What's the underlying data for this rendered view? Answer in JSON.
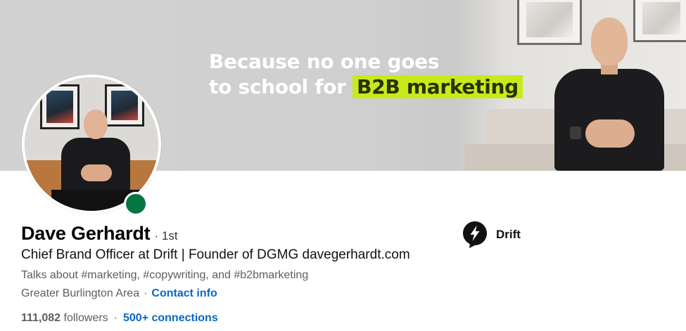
{
  "banner": {
    "tagline_line1": "Because no one goes",
    "tagline_line2_prefix": "to school for",
    "tagline_highlight": "B2B marketing",
    "highlight_color": "#c7ea1a"
  },
  "profile": {
    "name": "Dave Gerhardt",
    "degree": "· 1st",
    "headline": "Chief Brand Officer at Drift | Founder of DGMG davegerhardt.com",
    "topics": "Talks about #marketing, #copywriting, and #b2bmarketing",
    "location": "Greater Burlington Area",
    "contact_info_label": "Contact info",
    "followers_count": "111,082",
    "followers_label": "followers",
    "connections_label": "500+ connections",
    "online_status_color": "#057642"
  },
  "company": {
    "name": "Drift",
    "logo_icon": "drift-logo-icon"
  },
  "colors": {
    "link": "#0a66c2"
  }
}
